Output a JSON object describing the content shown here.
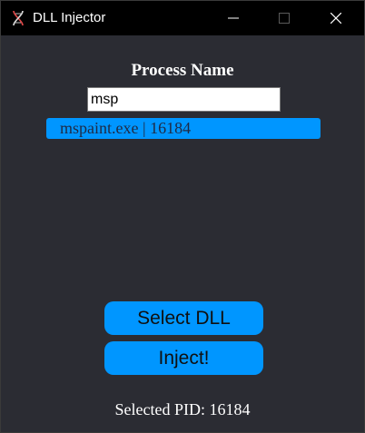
{
  "window": {
    "title": "DLL Injector",
    "icon": "dna-icon",
    "controls": [
      "minimize-icon",
      "maximize-icon",
      "close-icon"
    ]
  },
  "process_search": {
    "label": "Process Name",
    "value": "msp",
    "results": [
      {
        "text": "mspaint.exe | 16184"
      }
    ]
  },
  "actions": {
    "select_dll": "Select DLL",
    "inject": "Inject!"
  },
  "status": {
    "selected_pid_text": "Selected PID: 16184"
  },
  "colors": {
    "background": "#2b2c33",
    "titlebar": "#000000",
    "accent": "#0096ff",
    "text": "#ffffff"
  }
}
